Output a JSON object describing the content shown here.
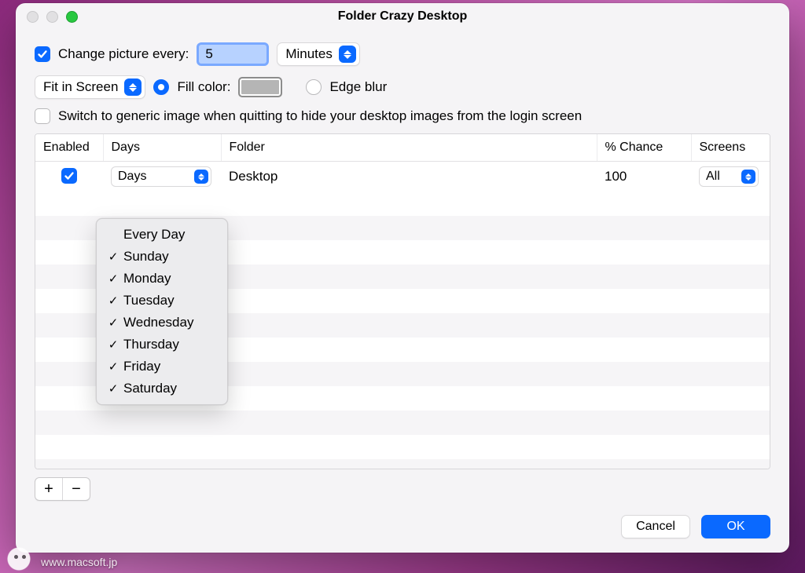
{
  "window": {
    "title": "Folder Crazy Desktop"
  },
  "settings": {
    "change_picture_label": "Change picture every:",
    "change_picture_checked": true,
    "interval_value": "5",
    "unit_selected": "Minutes",
    "fit_mode_selected": "Fit in Screen",
    "fill_color_selected": true,
    "fill_color_label": "Fill color:",
    "fill_color_swatch": "#b5b5b5",
    "edge_blur_selected": false,
    "edge_blur_label": "Edge blur",
    "generic_image_checked": false,
    "generic_image_label": "Switch to generic image when quitting to hide your desktop images from the login screen"
  },
  "table": {
    "columns": {
      "enabled": "Enabled",
      "days": "Days",
      "folder": "Folder",
      "chance": "% Chance",
      "screens": "Screens"
    },
    "rows": [
      {
        "enabled": true,
        "days_selected": "Days",
        "folder": "Desktop",
        "chance": "100",
        "screens_selected": "All"
      }
    ]
  },
  "days_menu": {
    "header": "Every Day",
    "options": [
      {
        "label": "Sunday",
        "checked": true
      },
      {
        "label": "Monday",
        "checked": true
      },
      {
        "label": "Tuesday",
        "checked": true
      },
      {
        "label": "Wednesday",
        "checked": true
      },
      {
        "label": "Thursday",
        "checked": true
      },
      {
        "label": "Friday",
        "checked": true
      },
      {
        "label": "Saturday",
        "checked": true
      }
    ]
  },
  "buttons": {
    "add": "+",
    "remove": "−",
    "cancel": "Cancel",
    "ok": "OK"
  },
  "watermark": "www.macsoft.jp"
}
